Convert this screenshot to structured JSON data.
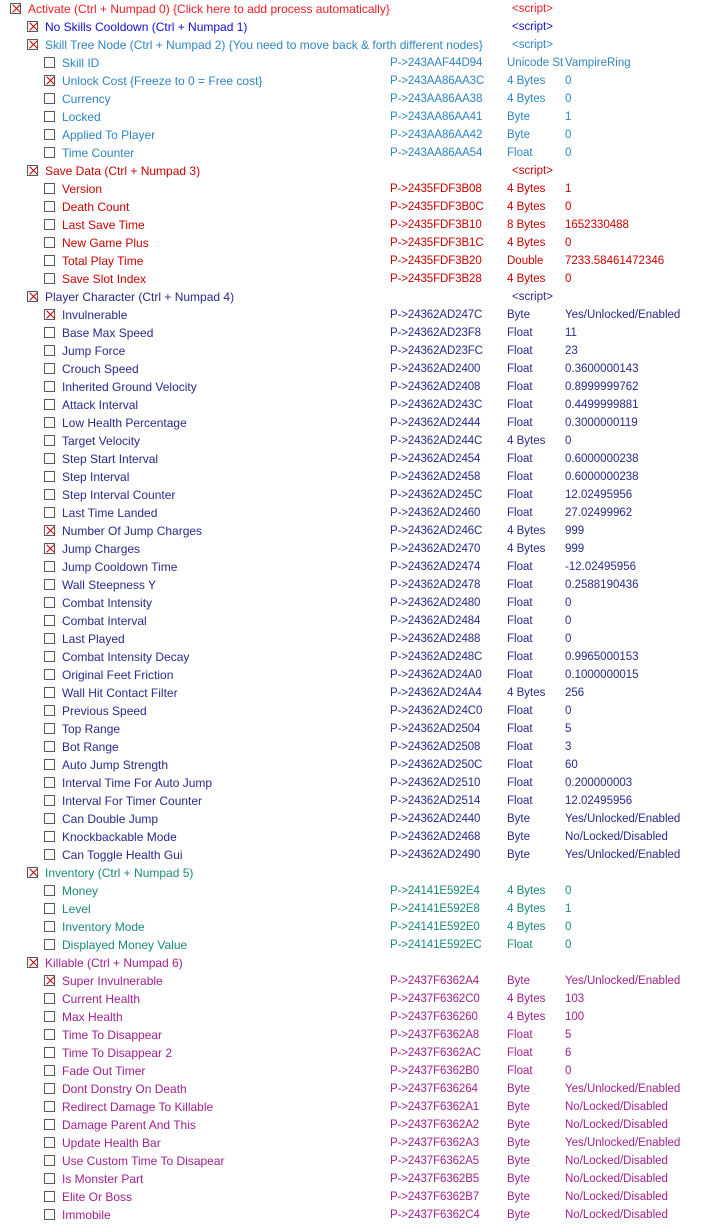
{
  "window": {
    "kind": "cheat-table-address-list",
    "script_label": "<script>"
  },
  "colors": {
    "activate_red": "#ED1C24",
    "script_blue": "#1111CC",
    "skilltree_blue": "#2E86C1",
    "savedata_red": "#CC0000",
    "player_blue": "#2A2A8C",
    "inventory_teal": "#1A8A7A",
    "killable_magenta": "#A0218E",
    "checkbox_border": "#5a5a5a",
    "check_mark": "#c00000",
    "background": "#ffffff"
  },
  "rows": [
    {
      "indent": 0,
      "checked": true,
      "color": "activate_red",
      "desc": "Activate (Ctrl + Numpad 0) {Click here to add process automatically}",
      "addr": "",
      "type": "",
      "value": "",
      "script": "<script>"
    },
    {
      "indent": 1,
      "checked": true,
      "color": "script_blue",
      "desc": "No Skills Cooldown (Ctrl + Numpad 1)",
      "addr": "",
      "type": "",
      "value": "",
      "script": "<script>"
    },
    {
      "indent": 1,
      "checked": true,
      "color": "skilltree_blue",
      "desc": "Skill Tree Node (Ctrl + Numpad 2) {You need to move back & forth different nodes}",
      "addr": "",
      "type": "",
      "value": "",
      "script": "<script>"
    },
    {
      "indent": 2,
      "checked": false,
      "color": "skilltree_blue",
      "desc": "Skill ID",
      "addr": "P->243AAF44D94",
      "type": "Unicode St",
      "value": "VampireRing",
      "script": ""
    },
    {
      "indent": 2,
      "checked": true,
      "color": "skilltree_blue",
      "desc": "Unlock Cost {Freeze to 0 = Free cost}",
      "addr": "P->243AA86AA3C",
      "type": "4 Bytes",
      "value": "0",
      "script": ""
    },
    {
      "indent": 2,
      "checked": false,
      "color": "skilltree_blue",
      "desc": "Currency",
      "addr": "P->243AA86AA38",
      "type": "4 Bytes",
      "value": "0",
      "script": ""
    },
    {
      "indent": 2,
      "checked": false,
      "color": "skilltree_blue",
      "desc": "Locked",
      "addr": "P->243AA86AA41",
      "type": "Byte",
      "value": "1",
      "script": ""
    },
    {
      "indent": 2,
      "checked": false,
      "color": "skilltree_blue",
      "desc": "Applied To Player",
      "addr": "P->243AA86AA42",
      "type": "Byte",
      "value": "0",
      "script": ""
    },
    {
      "indent": 2,
      "checked": false,
      "color": "skilltree_blue",
      "desc": "Time Counter",
      "addr": "P->243AA86AA54",
      "type": "Float",
      "value": "0",
      "script": ""
    },
    {
      "indent": 1,
      "checked": true,
      "color": "savedata_red",
      "desc": "Save Data (Ctrl + Numpad 3)",
      "addr": "",
      "type": "",
      "value": "",
      "script": "<script>"
    },
    {
      "indent": 2,
      "checked": false,
      "color": "savedata_red",
      "desc": "Version",
      "addr": "P->2435FDF3B08",
      "type": "4 Bytes",
      "value": "1",
      "script": ""
    },
    {
      "indent": 2,
      "checked": false,
      "color": "savedata_red",
      "desc": "Death Count",
      "addr": "P->2435FDF3B0C",
      "type": "4 Bytes",
      "value": "0",
      "script": ""
    },
    {
      "indent": 2,
      "checked": false,
      "color": "savedata_red",
      "desc": "Last Save Time",
      "addr": "P->2435FDF3B10",
      "type": "8 Bytes",
      "value": "1652330488",
      "script": ""
    },
    {
      "indent": 2,
      "checked": false,
      "color": "savedata_red",
      "desc": "New Game Plus",
      "addr": "P->2435FDF3B1C",
      "type": "4 Bytes",
      "value": "0",
      "script": ""
    },
    {
      "indent": 2,
      "checked": false,
      "color": "savedata_red",
      "desc": "Total Play Time",
      "addr": "P->2435FDF3B20",
      "type": "Double",
      "value": "7233.58461472346",
      "script": ""
    },
    {
      "indent": 2,
      "checked": false,
      "color": "savedata_red",
      "desc": "Save Slot Index",
      "addr": "P->2435FDF3B28",
      "type": "4 Bytes",
      "value": "0",
      "script": ""
    },
    {
      "indent": 1,
      "checked": true,
      "color": "player_blue",
      "desc": "Player Character (Ctrl + Numpad 4)",
      "addr": "",
      "type": "",
      "value": "",
      "script": "<script>"
    },
    {
      "indent": 2,
      "checked": true,
      "color": "player_blue",
      "desc": "Invulnerable",
      "addr": "P->24362AD247C",
      "type": "Byte",
      "value": "Yes/Unlocked/Enabled",
      "script": ""
    },
    {
      "indent": 2,
      "checked": false,
      "color": "player_blue",
      "desc": "Base Max Speed",
      "addr": "P->24362AD23F8",
      "type": "Float",
      "value": "11",
      "script": ""
    },
    {
      "indent": 2,
      "checked": false,
      "color": "player_blue",
      "desc": "Jump Force",
      "addr": "P->24362AD23FC",
      "type": "Float",
      "value": "23",
      "script": ""
    },
    {
      "indent": 2,
      "checked": false,
      "color": "player_blue",
      "desc": "Crouch Speed",
      "addr": "P->24362AD2400",
      "type": "Float",
      "value": "0.3600000143",
      "script": ""
    },
    {
      "indent": 2,
      "checked": false,
      "color": "player_blue",
      "desc": "Inherited Ground Velocity",
      "addr": "P->24362AD2408",
      "type": "Float",
      "value": "0.8999999762",
      "script": ""
    },
    {
      "indent": 2,
      "checked": false,
      "color": "player_blue",
      "desc": "Attack Interval",
      "addr": "P->24362AD243C",
      "type": "Float",
      "value": "0.4499999881",
      "script": ""
    },
    {
      "indent": 2,
      "checked": false,
      "color": "player_blue",
      "desc": "Low Health Percentage",
      "addr": "P->24362AD2444",
      "type": "Float",
      "value": "0.3000000119",
      "script": ""
    },
    {
      "indent": 2,
      "checked": false,
      "color": "player_blue",
      "desc": "Target Velocity",
      "addr": "P->24362AD244C",
      "type": "4 Bytes",
      "value": "0",
      "script": ""
    },
    {
      "indent": 2,
      "checked": false,
      "color": "player_blue",
      "desc": "Step Start Interval",
      "addr": "P->24362AD2454",
      "type": "Float",
      "value": "0.6000000238",
      "script": ""
    },
    {
      "indent": 2,
      "checked": false,
      "color": "player_blue",
      "desc": "Step Interval",
      "addr": "P->24362AD2458",
      "type": "Float",
      "value": "0.6000000238",
      "script": ""
    },
    {
      "indent": 2,
      "checked": false,
      "color": "player_blue",
      "desc": "Step Interval Counter",
      "addr": "P->24362AD245C",
      "type": "Float",
      "value": "12.02495956",
      "script": ""
    },
    {
      "indent": 2,
      "checked": false,
      "color": "player_blue",
      "desc": "Last Time Landed",
      "addr": "P->24362AD2460",
      "type": "Float",
      "value": "27.02499962",
      "script": ""
    },
    {
      "indent": 2,
      "checked": true,
      "color": "player_blue",
      "desc": "Number Of Jump Charges",
      "addr": "P->24362AD246C",
      "type": "4 Bytes",
      "value": "999",
      "script": ""
    },
    {
      "indent": 2,
      "checked": true,
      "color": "player_blue",
      "desc": "Jump Charges",
      "addr": "P->24362AD2470",
      "type": "4 Bytes",
      "value": "999",
      "script": ""
    },
    {
      "indent": 2,
      "checked": false,
      "color": "player_blue",
      "desc": "Jump Cooldown Time",
      "addr": "P->24362AD2474",
      "type": "Float",
      "value": "-12.02495956",
      "script": ""
    },
    {
      "indent": 2,
      "checked": false,
      "color": "player_blue",
      "desc": "Wall Steepness Y",
      "addr": "P->24362AD2478",
      "type": "Float",
      "value": "0.2588190436",
      "script": ""
    },
    {
      "indent": 2,
      "checked": false,
      "color": "player_blue",
      "desc": "Combat Intensity",
      "addr": "P->24362AD2480",
      "type": "Float",
      "value": "0",
      "script": ""
    },
    {
      "indent": 2,
      "checked": false,
      "color": "player_blue",
      "desc": "Combat Interval",
      "addr": "P->24362AD2484",
      "type": "Float",
      "value": "0",
      "script": ""
    },
    {
      "indent": 2,
      "checked": false,
      "color": "player_blue",
      "desc": "Last Played",
      "addr": "P->24362AD2488",
      "type": "Float",
      "value": "0",
      "script": ""
    },
    {
      "indent": 2,
      "checked": false,
      "color": "player_blue",
      "desc": "Combat Intensity Decay",
      "addr": "P->24362AD248C",
      "type": "Float",
      "value": "0.9965000153",
      "script": ""
    },
    {
      "indent": 2,
      "checked": false,
      "color": "player_blue",
      "desc": "Original Feet Friction",
      "addr": "P->24362AD24A0",
      "type": "Float",
      "value": "0.1000000015",
      "script": ""
    },
    {
      "indent": 2,
      "checked": false,
      "color": "player_blue",
      "desc": "Wall Hit Contact Filter",
      "addr": "P->24362AD24A4",
      "type": "4 Bytes",
      "value": "256",
      "script": ""
    },
    {
      "indent": 2,
      "checked": false,
      "color": "player_blue",
      "desc": "Previous Speed",
      "addr": "P->24362AD24C0",
      "type": "Float",
      "value": "0",
      "script": ""
    },
    {
      "indent": 2,
      "checked": false,
      "color": "player_blue",
      "desc": "Top Range",
      "addr": "P->24362AD2504",
      "type": "Float",
      "value": "5",
      "script": ""
    },
    {
      "indent": 2,
      "checked": false,
      "color": "player_blue",
      "desc": "Bot Range",
      "addr": "P->24362AD2508",
      "type": "Float",
      "value": "3",
      "script": ""
    },
    {
      "indent": 2,
      "checked": false,
      "color": "player_blue",
      "desc": "Auto Jump Strength",
      "addr": "P->24362AD250C",
      "type": "Float",
      "value": "60",
      "script": ""
    },
    {
      "indent": 2,
      "checked": false,
      "color": "player_blue",
      "desc": "Interval Time For Auto Jump",
      "addr": "P->24362AD2510",
      "type": "Float",
      "value": "0.200000003",
      "script": ""
    },
    {
      "indent": 2,
      "checked": false,
      "color": "player_blue",
      "desc": "Interval For Timer Counter",
      "addr": "P->24362AD2514",
      "type": "Float",
      "value": "12.02495956",
      "script": ""
    },
    {
      "indent": 2,
      "checked": false,
      "color": "player_blue",
      "desc": "Can Double Jump",
      "addr": "P->24362AD2440",
      "type": "Byte",
      "value": "Yes/Unlocked/Enabled",
      "script": ""
    },
    {
      "indent": 2,
      "checked": false,
      "color": "player_blue",
      "desc": "Knockbackable Mode",
      "addr": "P->24362AD2468",
      "type": "Byte",
      "value": "No/Locked/Disabled",
      "script": ""
    },
    {
      "indent": 2,
      "checked": false,
      "color": "player_blue",
      "desc": "Can Toggle Health Gui",
      "addr": "P->24362AD2490",
      "type": "Byte",
      "value": "Yes/Unlocked/Enabled",
      "script": ""
    },
    {
      "indent": 1,
      "checked": true,
      "color": "inventory_teal",
      "desc": "Inventory (Ctrl + Numpad 5)",
      "addr": "",
      "type": "",
      "value": "",
      "script": ""
    },
    {
      "indent": 2,
      "checked": false,
      "color": "inventory_teal",
      "desc": "Money",
      "addr": "P->24141E592E4",
      "type": "4 Bytes",
      "value": "0",
      "script": ""
    },
    {
      "indent": 2,
      "checked": false,
      "color": "inventory_teal",
      "desc": "Level",
      "addr": "P->24141E592E8",
      "type": "4 Bytes",
      "value": "1",
      "script": ""
    },
    {
      "indent": 2,
      "checked": false,
      "color": "inventory_teal",
      "desc": "Inventory Mode",
      "addr": "P->24141E592E0",
      "type": "4 Bytes",
      "value": "0",
      "script": ""
    },
    {
      "indent": 2,
      "checked": false,
      "color": "inventory_teal",
      "desc": "Displayed Money Value",
      "addr": "P->24141E592EC",
      "type": "Float",
      "value": "0",
      "script": ""
    },
    {
      "indent": 1,
      "checked": true,
      "color": "killable_magenta",
      "desc": "Killable (Ctrl + Numpad 6)",
      "addr": "",
      "type": "",
      "value": "",
      "script": ""
    },
    {
      "indent": 2,
      "checked": true,
      "color": "killable_magenta",
      "desc": "Super Invulnerable",
      "addr": "P->2437F6362A4",
      "type": "Byte",
      "value": "Yes/Unlocked/Enabled",
      "script": ""
    },
    {
      "indent": 2,
      "checked": false,
      "color": "killable_magenta",
      "desc": "Current Health",
      "addr": "P->2437F6362C0",
      "type": "4 Bytes",
      "value": "103",
      "script": ""
    },
    {
      "indent": 2,
      "checked": false,
      "color": "killable_magenta",
      "desc": "Max Health",
      "addr": "P->2437F636260",
      "type": "4 Bytes",
      "value": "100",
      "script": ""
    },
    {
      "indent": 2,
      "checked": false,
      "color": "killable_magenta",
      "desc": "Time To Disappear",
      "addr": "P->2437F6362A8",
      "type": "Float",
      "value": "5",
      "script": ""
    },
    {
      "indent": 2,
      "checked": false,
      "color": "killable_magenta",
      "desc": "Time To Disappear 2",
      "addr": "P->2437F6362AC",
      "type": "Float",
      "value": "6",
      "script": ""
    },
    {
      "indent": 2,
      "checked": false,
      "color": "killable_magenta",
      "desc": "Fade Out Timer",
      "addr": "P->2437F6362B0",
      "type": "Float",
      "value": "0",
      "script": ""
    },
    {
      "indent": 2,
      "checked": false,
      "color": "killable_magenta",
      "desc": "Dont Donstry On Death",
      "addr": "P->2437F636264",
      "type": "Byte",
      "value": "Yes/Unlocked/Enabled",
      "script": ""
    },
    {
      "indent": 2,
      "checked": false,
      "color": "killable_magenta",
      "desc": "Redirect Damage To Killable",
      "addr": "P->2437F6362A1",
      "type": "Byte",
      "value": "No/Locked/Disabled",
      "script": ""
    },
    {
      "indent": 2,
      "checked": false,
      "color": "killable_magenta",
      "desc": "Damage Parent And This",
      "addr": "P->2437F6362A2",
      "type": "Byte",
      "value": "No/Locked/Disabled",
      "script": ""
    },
    {
      "indent": 2,
      "checked": false,
      "color": "killable_magenta",
      "desc": "Update Health Bar",
      "addr": "P->2437F6362A3",
      "type": "Byte",
      "value": "Yes/Unlocked/Enabled",
      "script": ""
    },
    {
      "indent": 2,
      "checked": false,
      "color": "killable_magenta",
      "desc": "Use Custom Time To Disapear",
      "addr": "P->2437F6362A5",
      "type": "Byte",
      "value": "No/Locked/Disabled",
      "script": ""
    },
    {
      "indent": 2,
      "checked": false,
      "color": "killable_magenta",
      "desc": "Is Monster Part",
      "addr": "P->2437F6362B5",
      "type": "Byte",
      "value": "No/Locked/Disabled",
      "script": ""
    },
    {
      "indent": 2,
      "checked": false,
      "color": "killable_magenta",
      "desc": "Elite Or Boss",
      "addr": "P->2437F6362B7",
      "type": "Byte",
      "value": "No/Locked/Disabled",
      "script": ""
    },
    {
      "indent": 2,
      "checked": false,
      "color": "killable_magenta",
      "desc": "Immobile",
      "addr": "P->2437F6362C4",
      "type": "Byte",
      "value": "No/Locked/Disabled",
      "script": ""
    }
  ]
}
